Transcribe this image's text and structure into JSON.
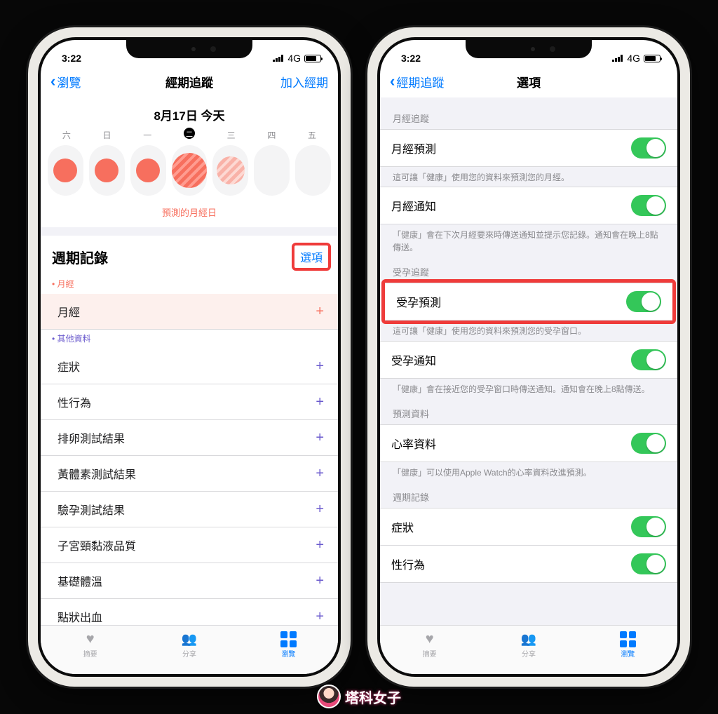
{
  "status": {
    "time": "3:22",
    "network": "4G"
  },
  "left": {
    "nav": {
      "back": "瀏覽",
      "title": "經期追蹤",
      "action": "加入經期"
    },
    "date_label": "8月17日 今天",
    "weekdays": [
      "六",
      "日",
      "一",
      "二",
      "三",
      "四",
      "五"
    ],
    "predicted_label": "預測的月經日",
    "cycle_header": "週期記錄",
    "options_link": "選項",
    "caps": {
      "period": "• 月經",
      "other": "• 其他資料"
    },
    "period_row": "月經",
    "other_rows": [
      "症狀",
      "性行為",
      "排卵測試結果",
      "黃體素測試結果",
      "驗孕測試結果",
      "子宮頸黏液品質",
      "基礎體溫",
      "點狀出血"
    ]
  },
  "right": {
    "nav": {
      "back": "經期追蹤",
      "title": "選項"
    },
    "groups": [
      {
        "header": "月經追蹤",
        "cells": [
          {
            "label": "月經預測",
            "footer": "這可讓「健康」使用您的資料來預測您的月經。"
          },
          {
            "label": "月經通知",
            "footer": "「健康」會在下次月經要來時傳送通知並提示您記錄。通知會在晚上8點傳送。"
          }
        ]
      },
      {
        "header": "受孕追蹤",
        "cells": [
          {
            "label": "受孕預測",
            "highlight": true,
            "footer": "這可讓「健康」使用您的資料來預測您的受孕窗口。"
          },
          {
            "label": "受孕通知",
            "footer": "「健康」會在接近您的受孕窗口時傳送通知。通知會在晚上8點傳送。"
          }
        ]
      },
      {
        "header": "預測資料",
        "cells": [
          {
            "label": "心率資料",
            "footer": "「健康」可以使用Apple Watch的心率資料改進預測。"
          }
        ]
      },
      {
        "header": "週期記錄",
        "cells": [
          {
            "label": "症狀"
          },
          {
            "label": "性行為"
          }
        ]
      }
    ]
  },
  "tabs": [
    {
      "label": "摘要",
      "icon": "heart"
    },
    {
      "label": "分享",
      "icon": "share"
    },
    {
      "label": "瀏覽",
      "icon": "grid",
      "active": true
    }
  ],
  "watermark": "塔科女子"
}
